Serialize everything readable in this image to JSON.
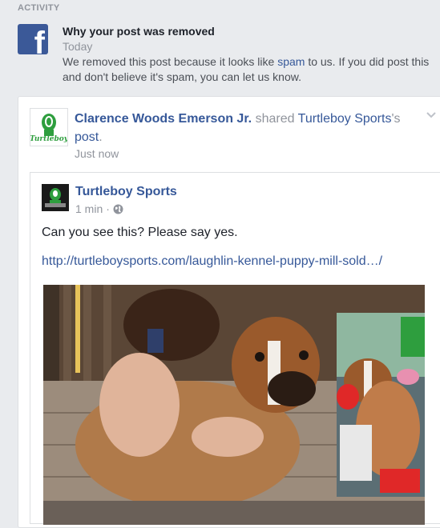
{
  "section_label": "ACTIVITY",
  "notice": {
    "icon": "facebook-logo-icon",
    "title": "Why your post was removed",
    "date": "Today",
    "body_before_link": "We removed this post because it looks like ",
    "body_link": "spam",
    "body_after_link": " to us. If you did post this and don't believe it's spam, you can let us know."
  },
  "shared_post": {
    "sharer_name": "Clarence Woods Emerson Jr.",
    "shared_word": " shared ",
    "page_name": "Turtleboy Sports",
    "possessive": "'s",
    "post_word": "post",
    "period": ".",
    "time": "Just now",
    "sharer_avatar_text": "Turtleboy",
    "menu_icon": "chevron-down-icon"
  },
  "original_post": {
    "page_name": "Turtleboy Sports",
    "time": "1 min",
    "separator": " · ",
    "privacy_icon": "globe-icon",
    "text": "Can you see this? Please say yes.",
    "link": "http://turtleboysports.com/laughlin-kennel-puppy-mill-sold…/",
    "preview_image": "boy-hugging-boxer-dog-photo"
  },
  "colors": {
    "background": "#e9ebee",
    "link_blue": "#365899",
    "facebook_blue": "#3b5998",
    "muted_gray": "#90949c",
    "turtle_green": "#2e9e3e"
  }
}
